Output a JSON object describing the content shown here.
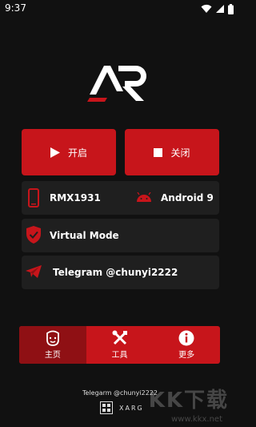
{
  "status_bar": {
    "time": "9:37"
  },
  "buttons": {
    "start_label": "开启",
    "stop_label": "关闭"
  },
  "device": {
    "model": "RMX1931",
    "android": "Android 9"
  },
  "mode": {
    "label": "Virtual Mode"
  },
  "telegram": {
    "label": "Telegram @chunyi2222"
  },
  "nav": [
    {
      "label": "主页",
      "icon": "face-icon"
    },
    {
      "label": "工具",
      "icon": "tools-icon"
    },
    {
      "label": "更多",
      "icon": "info-icon"
    }
  ],
  "footer": {
    "telegram": "Telegarm @chunyi2222",
    "brand": "XARG"
  },
  "watermark": {
    "big": "KK下载",
    "small": "www.kkx.net"
  },
  "colors": {
    "accent": "#c7151b",
    "accent_dark": "#8f1014",
    "background": "#111111",
    "card": "#1f1f1f"
  }
}
